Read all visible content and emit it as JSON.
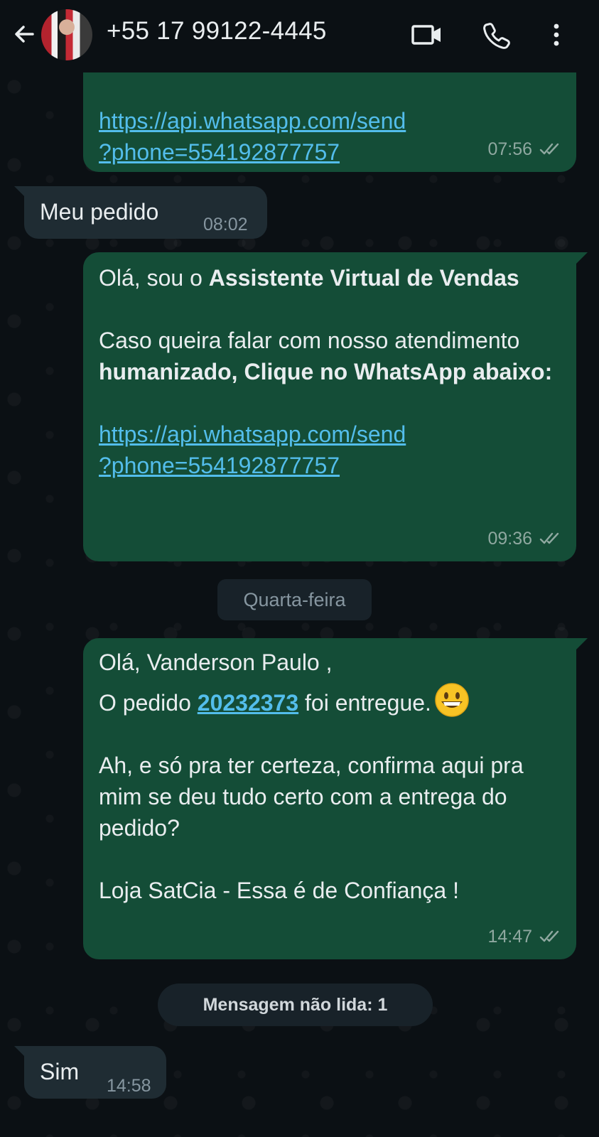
{
  "header": {
    "contact_name": "+55 17 99122-4445",
    "icons": [
      "back-arrow-icon",
      "video-call-icon",
      "voice-call-icon",
      "more-options-icon"
    ]
  },
  "messages": {
    "m1": {
      "link_line1": "https://api.whatsapp.com/send",
      "link_line2": "?phone=554192877757",
      "time": "07:56"
    },
    "m2": {
      "text": "Meu pedido",
      "time": "08:02"
    },
    "m3": {
      "greet_prefix": "Olá, sou o ",
      "greet_bold": "Assistente Virtual de Vendas",
      "body_prefix": "Caso queira falar com nosso atendimento ",
      "body_bold": "humanizado, Clique no WhatsApp abaixo:",
      "link_line1": "https://api.whatsapp.com/send",
      "link_line2": "?phone=554192877757",
      "time": "09:36"
    },
    "date_divider": "Quarta-feira",
    "m4": {
      "line1": "Olá, Vanderson Paulo ,",
      "line2_prefix": "O pedido ",
      "order_number": "20232373",
      "line2_suffix": " foi entregue.",
      "para2": "Ah, e só pra ter certeza, confirma aqui pra mim se deu tudo certo com a entrega do pedido?",
      "para3": "Loja SatCia - Essa é de Confiança !",
      "time": "14:47"
    },
    "unread_divider": "Mensagem não lida: 1",
    "m5": {
      "text": "Sim",
      "time": "14:58"
    }
  },
  "colors": {
    "outgoing_bubble": "#144d37",
    "incoming_bubble": "#1f2c33",
    "link": "#53bdeb",
    "background": "#0b1014"
  }
}
